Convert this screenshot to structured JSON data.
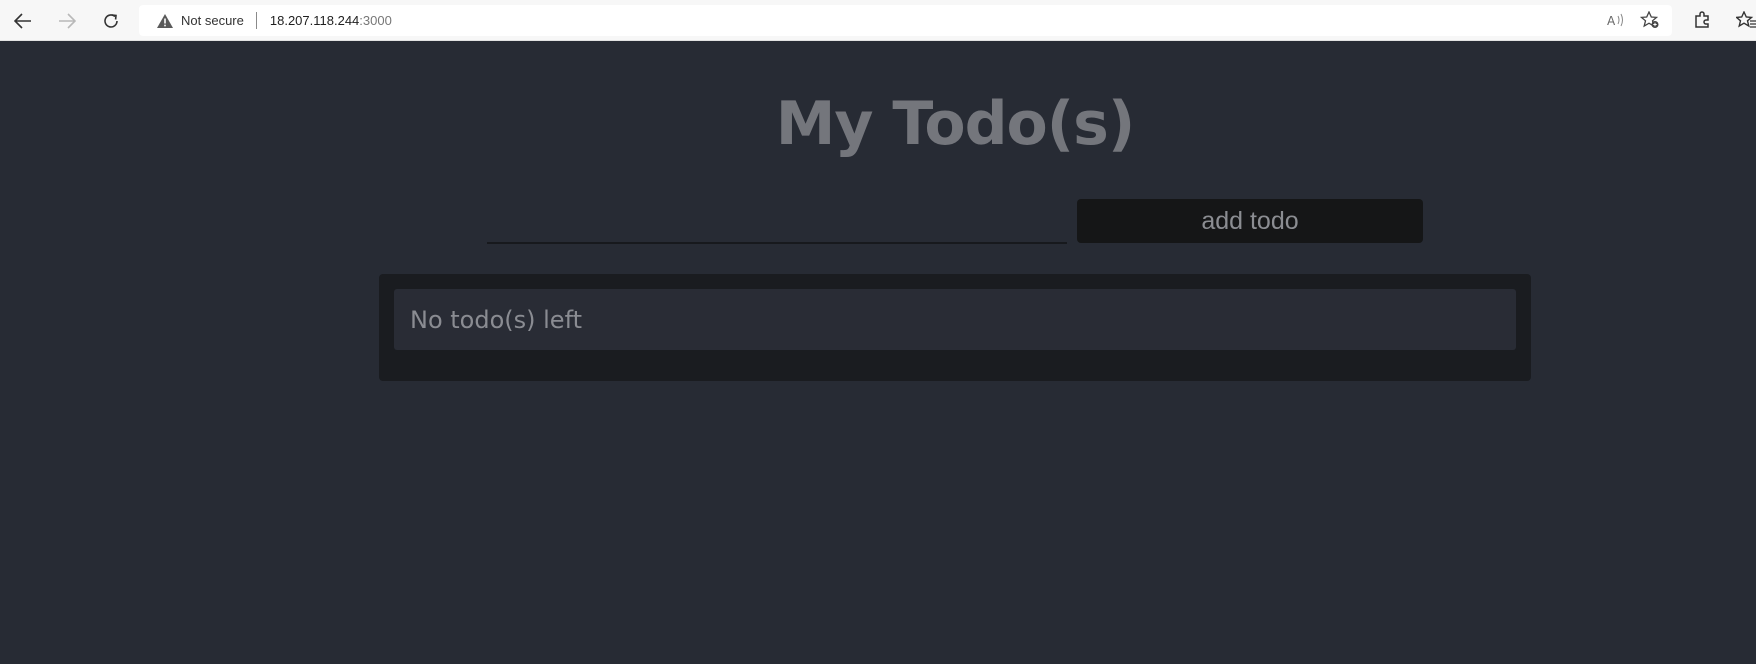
{
  "browser": {
    "security_label": "Not secure",
    "url_host": "18.207.118.244",
    "url_port": ":3000",
    "icons": [
      "back-icon",
      "forward-icon",
      "reload-icon",
      "warning-icon",
      "read-aloud-icon",
      "add-favorite-icon",
      "extensions-icon",
      "favorites-icon"
    ]
  },
  "page": {
    "title": "My Todo(s)",
    "input": {
      "value": "",
      "placeholder": ""
    },
    "add_button_label": "add todo",
    "empty_message": "No todo(s) left"
  },
  "colors": {
    "background": "#272b34",
    "card": "#1a1c20",
    "row": "#292c35",
    "button": "#151617",
    "title_text": "#74767c"
  }
}
